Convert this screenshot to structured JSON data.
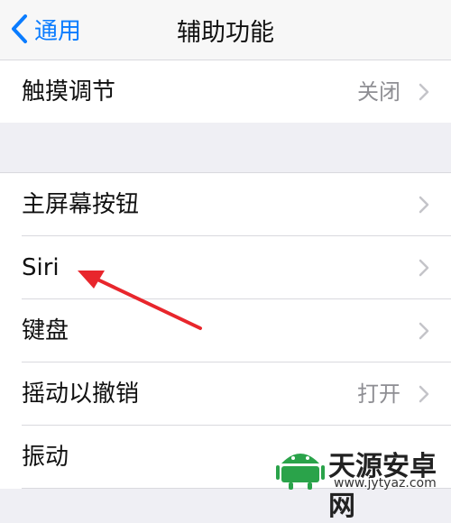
{
  "nav": {
    "back_label": "通用",
    "title": "辅助功能"
  },
  "rows": [
    {
      "label": "触摸调节",
      "value": "关闭"
    },
    {
      "label": "主屏幕按钮",
      "value": ""
    },
    {
      "label": "Siri",
      "value": ""
    },
    {
      "label": "键盘",
      "value": ""
    },
    {
      "label": "摇动以撤销",
      "value": "打开"
    },
    {
      "label": "振动",
      "value": ""
    }
  ],
  "watermark": {
    "name": "天源安卓网",
    "url": "www.jytyaz.com"
  },
  "colors": {
    "accent": "#0a7cff",
    "annotation": "#e8262c",
    "watermark_green": "#2aa34a"
  }
}
